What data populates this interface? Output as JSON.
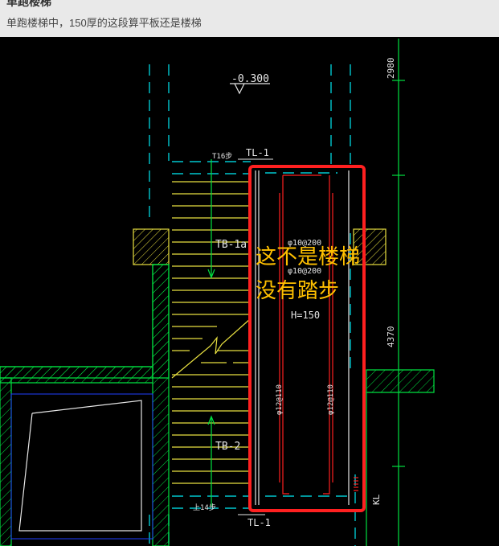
{
  "post": {
    "title": "单跑楼梯",
    "body": "单跑楼梯中，150厚的这段算平板还是楼梯"
  },
  "drawing": {
    "elevation": "-0.300",
    "top_beam": "TL-1",
    "bottom_beam": "TL-1",
    "top_step_label": "T16步",
    "bottom_step_label": "上14步",
    "upper_flight": "TB-1a",
    "lower_flight": "TB-2",
    "rebar_top_1": "φ10@200",
    "rebar_top_2": "φ10@200",
    "slab_thickness": "H=150",
    "rebar_left": "φ12@110",
    "rebar_right": "φ12@110",
    "dim_top": "2980",
    "dim_mid": "4370",
    "side_beam": "KL",
    "annotation_line1": "这不是楼梯",
    "annotation_line2": "没有踏步"
  },
  "colors": {
    "header_bg": "#e9e9e9",
    "cad_bg": "#000000",
    "cyan": "#00c8d0",
    "yellow": "#e8e040",
    "green": "#00e040",
    "white": "#e6e6e6",
    "red": "#ff2020",
    "annotation": "#ffc000"
  }
}
